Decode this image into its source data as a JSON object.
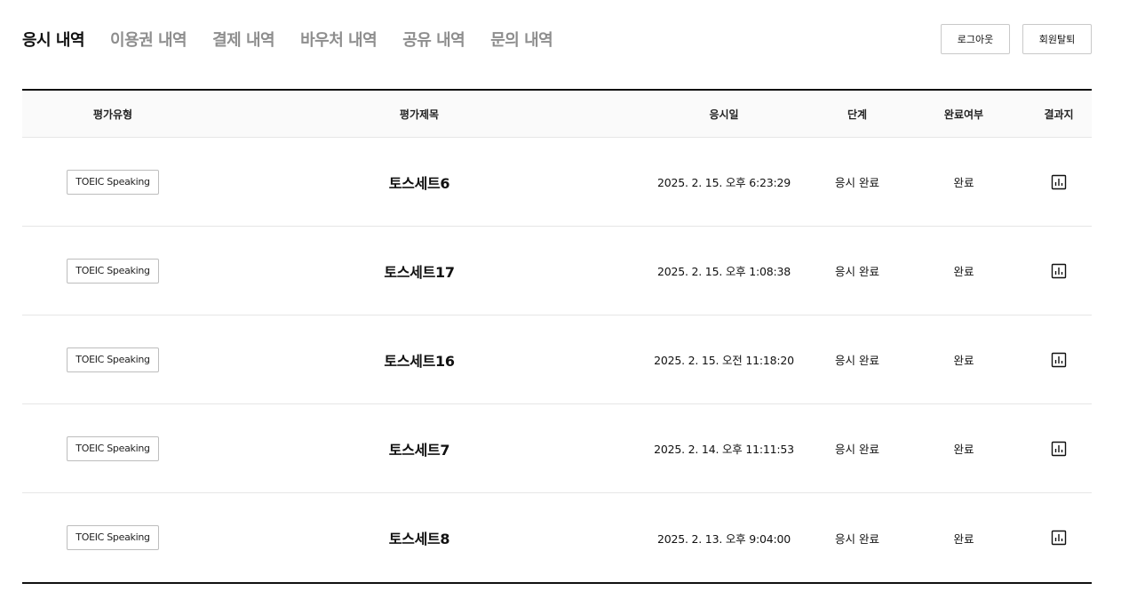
{
  "tabs": [
    {
      "label": "응시 내역",
      "active": true
    },
    {
      "label": "이용권 내역",
      "active": false
    },
    {
      "label": "결제 내역",
      "active": false
    },
    {
      "label": "바우처 내역",
      "active": false
    },
    {
      "label": "공유 내역",
      "active": false
    },
    {
      "label": "문의 내역",
      "active": false
    }
  ],
  "actions": {
    "logout_label": "로그아웃",
    "withdraw_label": "회원탈퇴"
  },
  "table": {
    "headers": {
      "type": "평가유형",
      "title": "평가제목",
      "date": "응시일",
      "stage": "단계",
      "completion": "완료여부",
      "result": "결과지"
    },
    "rows": [
      {
        "type": "TOEIC Speaking",
        "title": "토스세트6",
        "date": "2025. 2. 15. 오후 6:23:29",
        "stage": "응시 완료",
        "completion": "완료",
        "result_icon": "bar-chart-icon"
      },
      {
        "type": "TOEIC Speaking",
        "title": "토스세트17",
        "date": "2025. 2. 15. 오후 1:08:38",
        "stage": "응시 완료",
        "completion": "완료",
        "result_icon": "bar-chart-icon"
      },
      {
        "type": "TOEIC Speaking",
        "title": "토스세트16",
        "date": "2025. 2. 15. 오전 11:18:20",
        "stage": "응시 완료",
        "completion": "완료",
        "result_icon": "bar-chart-icon"
      },
      {
        "type": "TOEIC Speaking",
        "title": "토스세트7",
        "date": "2025. 2. 14. 오후 11:11:53",
        "stage": "응시 완료",
        "completion": "완료",
        "result_icon": "bar-chart-icon"
      },
      {
        "type": "TOEIC Speaking",
        "title": "토스세트8",
        "date": "2025. 2. 13. 오후 9:04:00",
        "stage": "응시 완료",
        "completion": "완료",
        "result_icon": "bar-chart-icon"
      }
    ]
  }
}
